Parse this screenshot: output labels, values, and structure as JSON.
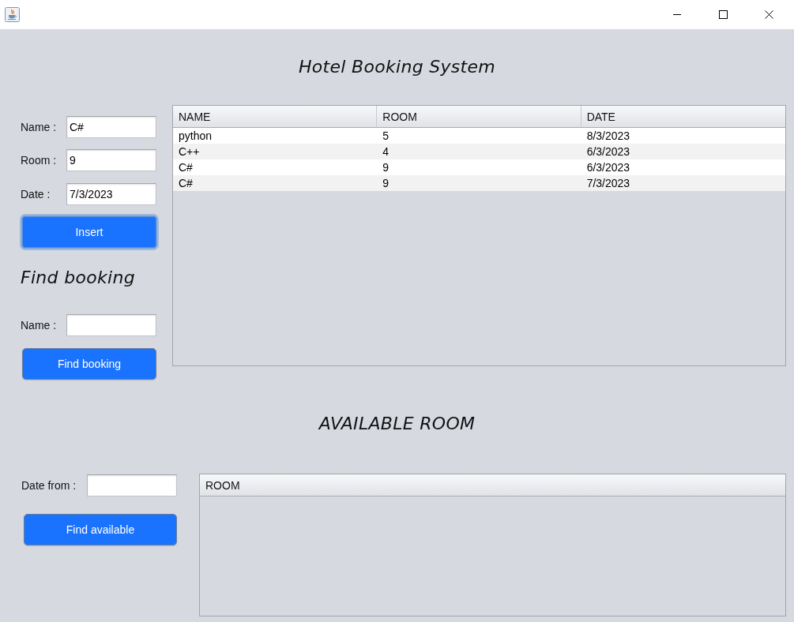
{
  "title": "Hotel Booking System",
  "insert_form": {
    "fields": [
      {
        "label": "Name :",
        "value": "C#"
      },
      {
        "label": "Room :",
        "value": "9"
      },
      {
        "label": "Date :",
        "value": "7/3/2023"
      }
    ],
    "button": {
      "label": "Insert",
      "focused": true
    }
  },
  "find_booking": {
    "heading": "Find booking",
    "fields": [
      {
        "label": "Name :"
      }
    ],
    "button": {
      "label": "Find booking",
      "focused": false
    }
  },
  "bookings_table": {
    "columns": [
      "NAME",
      "ROOM",
      "DATE"
    ],
    "rows": [
      [
        "python",
        "5",
        "8/3/2023"
      ],
      [
        "C++",
        "4",
        "6/3/2023"
      ],
      [
        "C#",
        "9",
        "6/3/2023"
      ],
      [
        "C#",
        "9",
        "7/3/2023"
      ]
    ]
  },
  "available_room": {
    "heading": "AVAILABLE ROOM",
    "fields": [
      {
        "label": "Date from :"
      }
    ],
    "button": {
      "label": "Find available",
      "focused": false
    },
    "table": {
      "columns": [
        "ROOM"
      ]
    }
  }
}
